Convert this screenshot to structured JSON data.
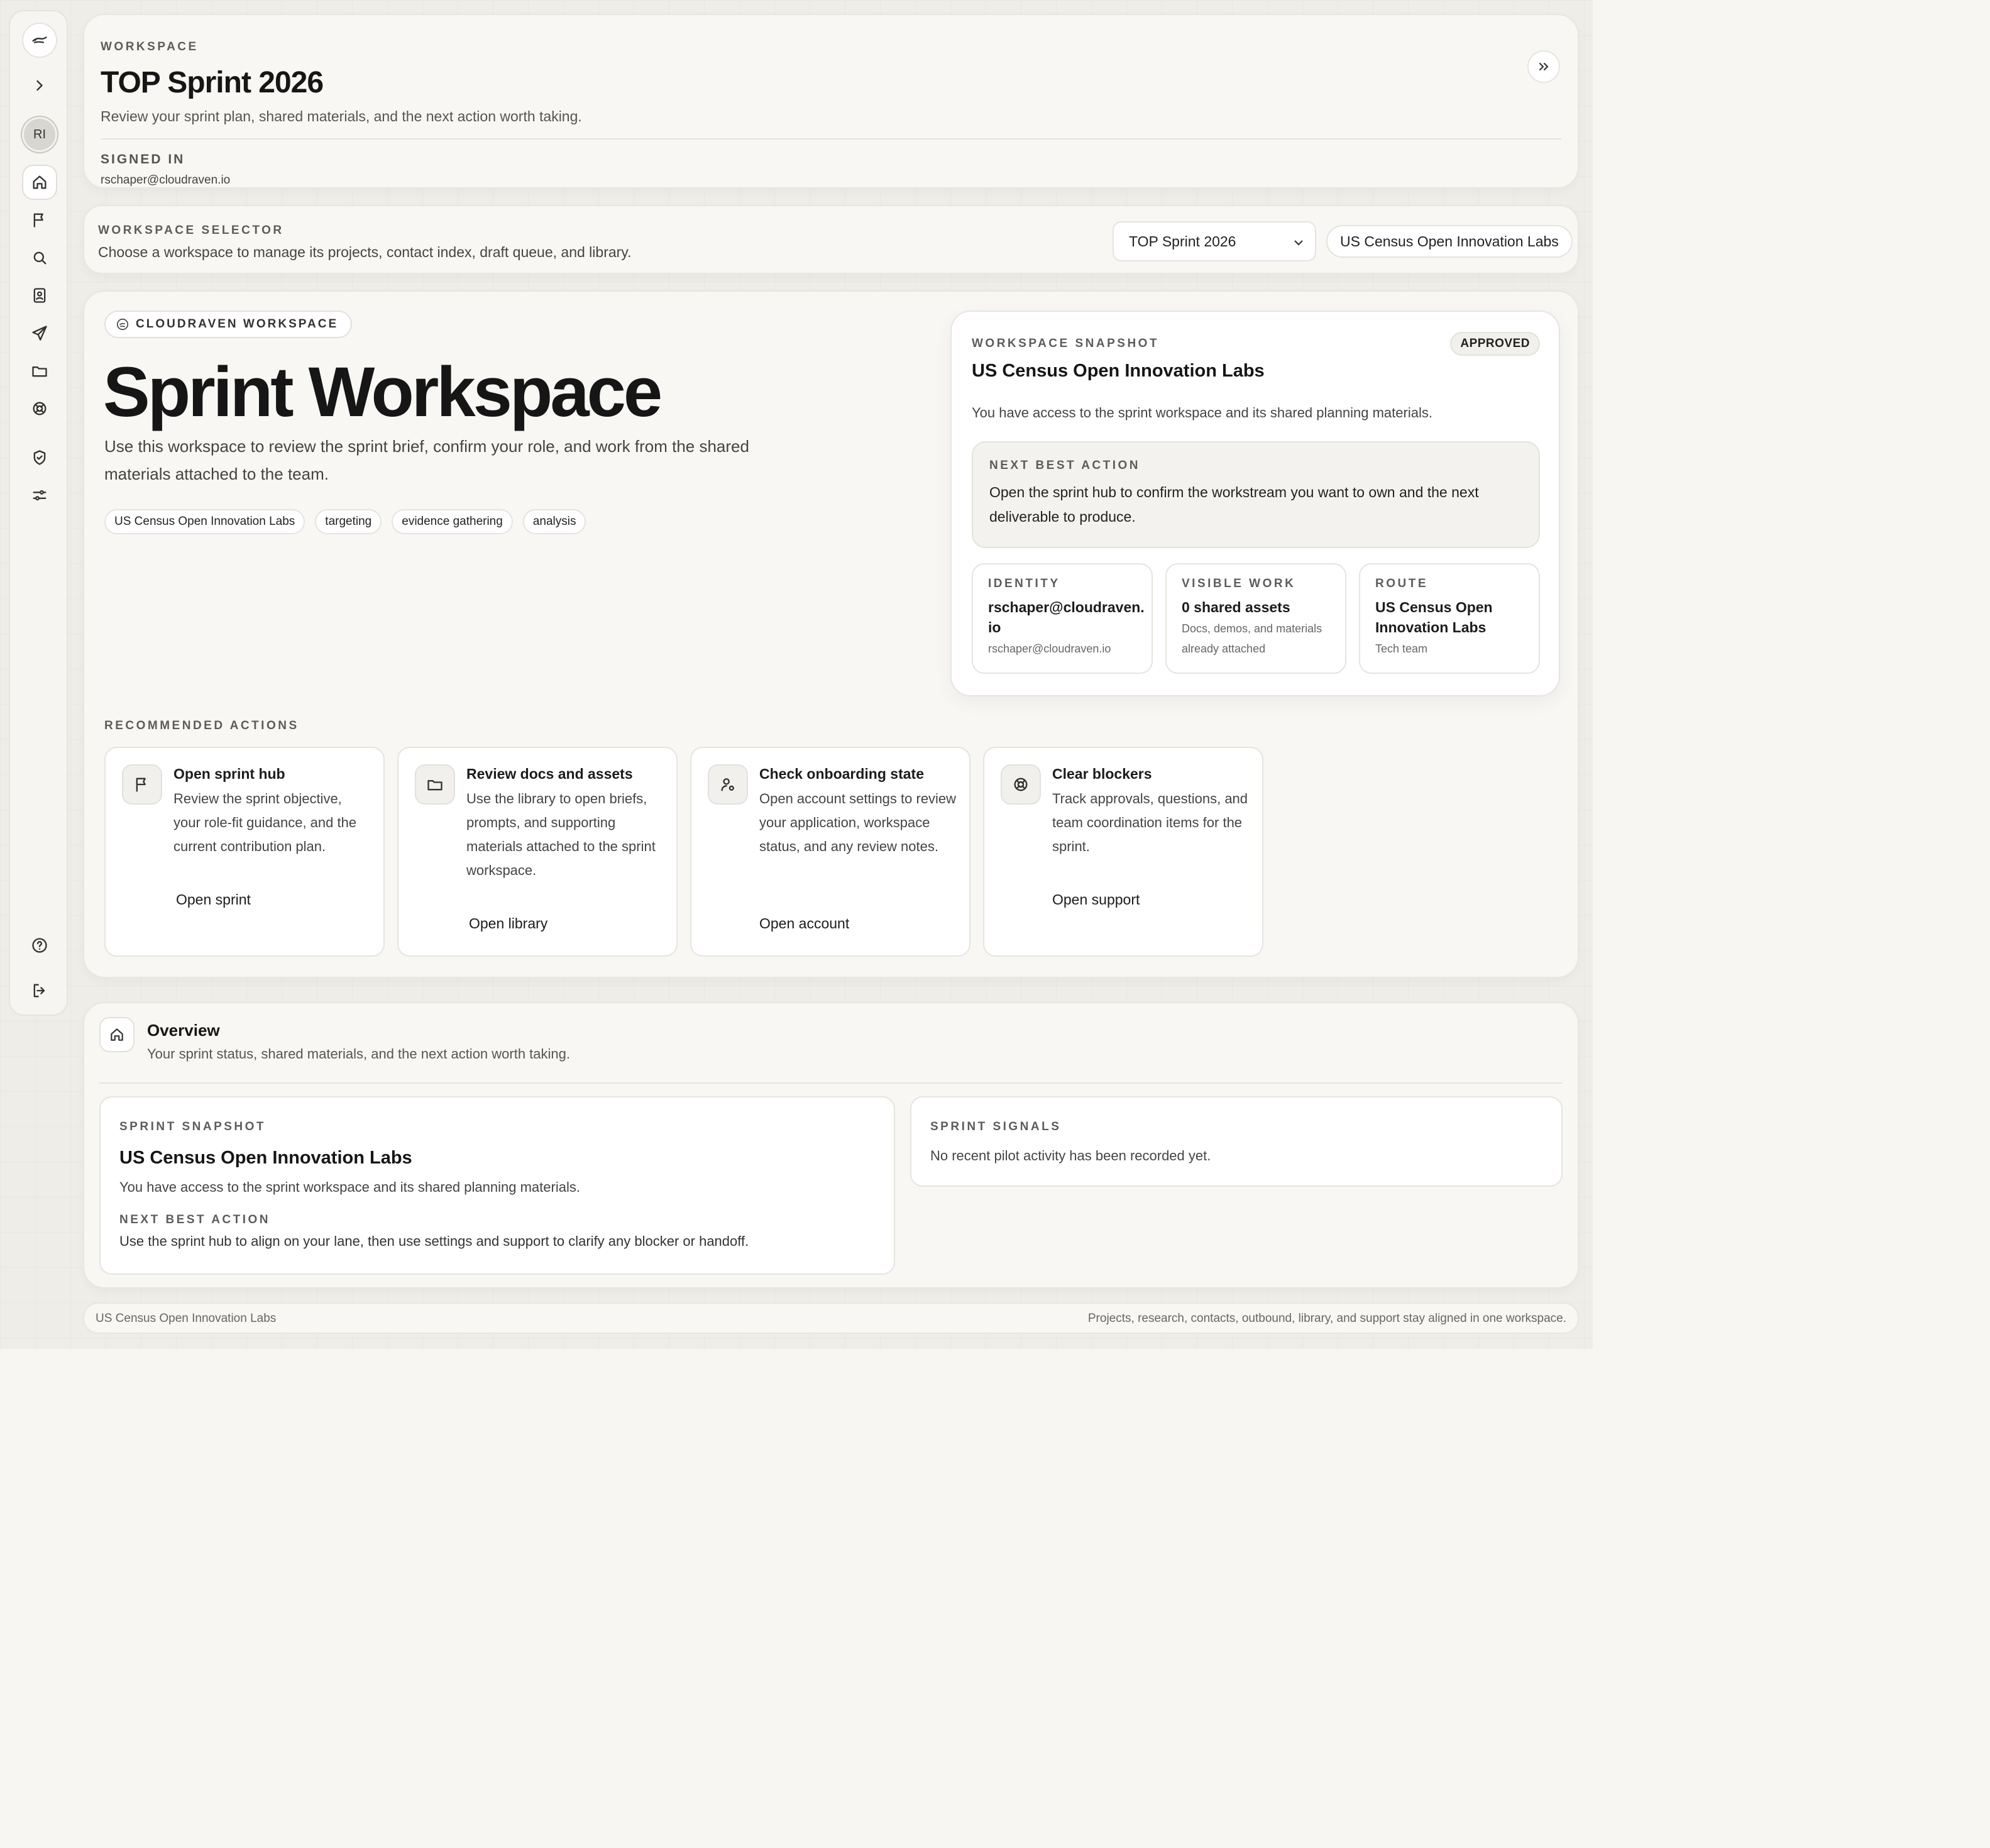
{
  "sidebar": {
    "avatar_initials": "RI",
    "icons": [
      "logo-icon",
      "chevron-right-icon",
      "home-icon",
      "flag-icon",
      "search-icon",
      "contacts-icon",
      "send-icon",
      "folder-icon",
      "lifebuoy-icon",
      "shield-icon",
      "sliders-icon",
      "help-icon",
      "logout-icon"
    ]
  },
  "header": {
    "eyebrow": "WORKSPACE",
    "title": "TOP Sprint 2026",
    "subtitle": "Review your sprint plan, shared materials, and the next action worth taking.",
    "signed_in_label": "SIGNED IN",
    "email": "rschaper@cloudraven.io"
  },
  "selector": {
    "eyebrow": "WORKSPACE SELECTOR",
    "description": "Choose a workspace to manage its projects, contact index, draft queue, and library.",
    "selected_workspace": "TOP Sprint 2026",
    "organization": "US Census Open Innovation Labs"
  },
  "hero": {
    "brand": "CLOUDRAVEN WORKSPACE",
    "title": "Sprint Workspace",
    "lead": "Use this workspace to review the sprint brief, confirm your role, and work from the shared materials attached to the team.",
    "tags": [
      "US Census Open Innovation Labs",
      "targeting",
      "evidence gathering",
      "analysis"
    ]
  },
  "snapshot": {
    "eyebrow": "WORKSPACE SNAPSHOT",
    "status": "APPROVED",
    "title": "US Census Open Innovation Labs",
    "access": "You have access to the sprint workspace and its shared planning materials.",
    "nba_label": "NEXT BEST ACTION",
    "nba_text": "Open the sprint hub to confirm the workstream you want to own and the next deliverable to produce.",
    "identity": {
      "label": "IDENTITY",
      "value": "rschaper@cloudraven.io",
      "note": "rschaper@cloudraven.io"
    },
    "visible_work": {
      "label": "VISIBLE WORK",
      "value": "0 shared assets",
      "note": "Docs, demos, and materials already attached"
    },
    "route": {
      "label": "ROUTE",
      "value": "US Census Open Innovation Labs",
      "note": "Tech team"
    }
  },
  "recommended": {
    "label": "RECOMMENDED ACTIONS",
    "actions": [
      {
        "title": "Open sprint hub",
        "body": "Review the sprint objective, your role-fit guidance, and the current contribution plan.",
        "link": "Open sprint",
        "icon": "flag-icon"
      },
      {
        "title": "Review docs and assets",
        "body": "Use the library to open briefs, prompts, and supporting materials attached to the sprint workspace.",
        "link": "Open library",
        "icon": "folder-icon"
      },
      {
        "title": "Check onboarding state",
        "body": "Open account settings to review your application, workspace status, and any review notes.",
        "link": "Open account",
        "icon": "user-settings-icon"
      },
      {
        "title": "Clear blockers",
        "body": "Track approvals, questions, and team coordination items for the sprint.",
        "link": "Open support",
        "icon": "lifebuoy-icon"
      }
    ]
  },
  "overview": {
    "title": "Overview",
    "subtitle": "Your sprint status, shared materials, and the next action worth taking.",
    "sprint_snapshot": {
      "eyebrow": "SPRINT SNAPSHOT",
      "title": "US Census Open Innovation Labs",
      "text": "You have access to the sprint workspace and its shared planning materials.",
      "nba_label": "NEXT BEST ACTION",
      "nba_text": "Use the sprint hub to align on your lane, then use settings and support to clarify any blocker or handoff."
    },
    "signals": {
      "eyebrow": "SPRINT SIGNALS",
      "text": "No recent pilot activity has been recorded yet."
    }
  },
  "footer": {
    "left": "US Census Open Innovation Labs",
    "right": "Projects, research, contacts, outbound, library, and support stay aligned in one workspace."
  }
}
